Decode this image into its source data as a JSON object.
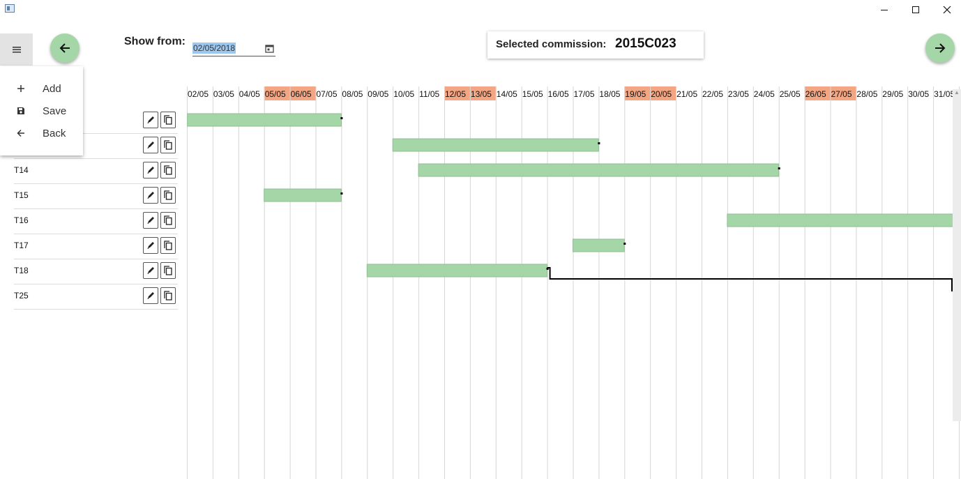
{
  "window": {
    "controls": [
      {
        "name": "minimize-button",
        "icon": "minimize-icon"
      },
      {
        "name": "maximize-button",
        "icon": "maximize-icon"
      },
      {
        "name": "close-button",
        "icon": "close-icon"
      }
    ]
  },
  "menu": {
    "toggle_icon": "hamburger-icon",
    "items": [
      {
        "label": "Add",
        "icon": "plus-icon"
      },
      {
        "label": "Save",
        "icon": "floppy-disk-icon"
      },
      {
        "label": "Back",
        "icon": "arrow-left-icon"
      }
    ]
  },
  "toolbar": {
    "prev_icon": "arrow-left-icon",
    "next_icon": "arrow-right-icon",
    "show_from_label": "Show from:",
    "date_value": "02/05/2018",
    "calendar_icon": "calendar-icon",
    "commission_label": "Selected commission:",
    "commission_value": "2015C023"
  },
  "colors": {
    "accent_green": "#a5d6a7",
    "weekend": "#f4a582",
    "date_selection": "#9cc8ef"
  },
  "tasks": [
    {
      "label": "",
      "start": "02/05",
      "end": "07/05"
    },
    {
      "label": "",
      "start": "10/05",
      "end": "17/05"
    },
    {
      "label": "T14",
      "start": "11/05",
      "end": "24/05"
    },
    {
      "label": "T15",
      "start": "05/05",
      "end": "07/05"
    },
    {
      "label": "T16",
      "start": "23/05",
      "end": "31/05"
    },
    {
      "label": "T17",
      "start": "17/05",
      "end": "18/05"
    },
    {
      "label": "T18",
      "start": "09/05",
      "end": "15/05"
    },
    {
      "label": "T25",
      "start": "",
      "end": ""
    }
  ],
  "row_buttons": {
    "edit_icon": "pencil-icon",
    "copy_icon": "copy-icon"
  },
  "dependency": {
    "from": "T18",
    "to": "T25"
  },
  "timeline": {
    "days": [
      "02/05",
      "03/05",
      "04/05",
      "05/05",
      "06/05",
      "07/05",
      "08/05",
      "09/05",
      "10/05",
      "11/05",
      "12/05",
      "13/05",
      "14/05",
      "15/05",
      "16/05",
      "17/05",
      "18/05",
      "19/05",
      "20/05",
      "21/05",
      "22/05",
      "23/05",
      "24/05",
      "25/05",
      "26/05",
      "27/05",
      "28/05",
      "29/05",
      "30/05",
      "31/05"
    ],
    "weekends": [
      "05/05",
      "06/05",
      "12/05",
      "13/05",
      "19/05",
      "20/05",
      "26/05",
      "27/05"
    ]
  }
}
